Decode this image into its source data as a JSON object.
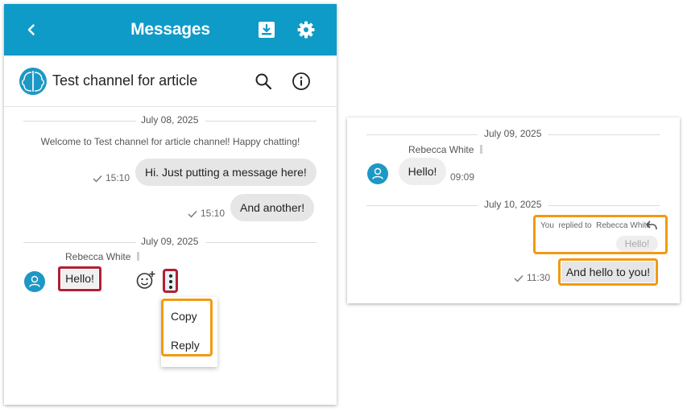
{
  "left_panel": {
    "app_title": "Messages",
    "channel_title": "Test channel for article",
    "date1": "July 08, 2025",
    "system_message": "Welcome to Test channel for article channel! Happy chatting!",
    "outgoing": [
      {
        "text": "Hi. Just putting a message here!",
        "time": "15:10"
      },
      {
        "text": "And another!",
        "time": "15:10"
      }
    ],
    "date2": "July 09, 2025",
    "sender": "Rebecca White",
    "incoming_text": "Hello!",
    "menu": [
      "Copy",
      "Reply"
    ]
  },
  "right_panel": {
    "date1": "July 09, 2025",
    "sender": "Rebecca White",
    "incoming_text": "Hello!",
    "incoming_time": "09:09",
    "date2": "July 10, 2025",
    "reply_you": "You",
    "reply_label": "replied to",
    "reply_target": "Rebecca White",
    "quoted_text": "Hello!",
    "outgoing_text": "And hello to you!",
    "outgoing_time": "11:30"
  },
  "icons": {
    "back": "chevron-left-icon",
    "download": "download-icon",
    "settings": "gear-icon",
    "search": "search-icon",
    "info": "info-icon",
    "read": "check-icon",
    "emoji": "add-reaction-icon",
    "more": "more-vertical-icon",
    "reply": "reply-icon"
  },
  "colors": {
    "primary": "#0f9bc8",
    "highlight_red": "#b11f34",
    "highlight_orange": "#f29a12"
  }
}
